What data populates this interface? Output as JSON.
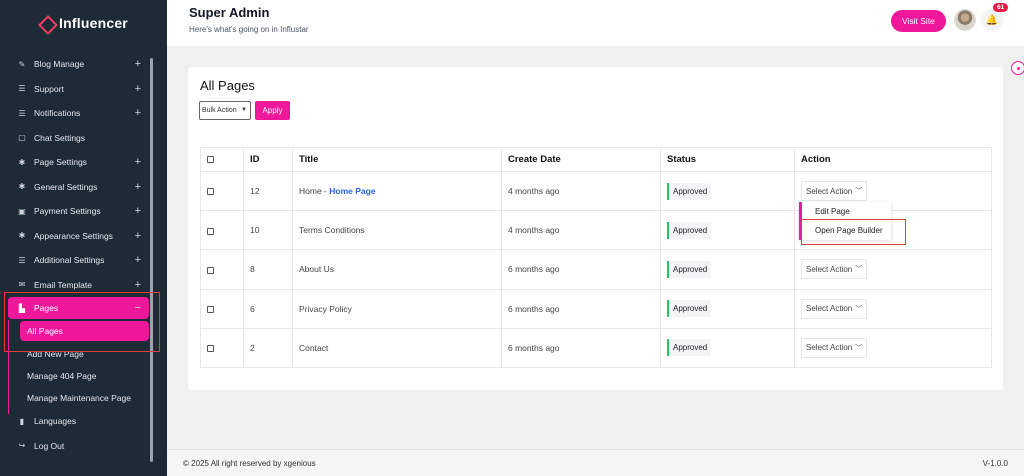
{
  "brand": {
    "name": "Influencer",
    "accent": "#f0189a"
  },
  "header": {
    "title": "Super Admin",
    "subtitle": "Here's what's going on in Influstar",
    "visit_label": "Visit Site",
    "notif_count": "61"
  },
  "sidebar": {
    "items": [
      {
        "label": "Blog Manage",
        "icon": "blog-icon",
        "expandable": true
      },
      {
        "label": "Support",
        "icon": "list-icon",
        "expandable": true
      },
      {
        "label": "Notifications",
        "icon": "list-icon",
        "expandable": true
      },
      {
        "label": "Chat Settings",
        "icon": "chat-icon",
        "expandable": false
      },
      {
        "label": "Page Settings",
        "icon": "gear-icon",
        "expandable": true
      },
      {
        "label": "General Settings",
        "icon": "gear-icon",
        "expandable": true
      },
      {
        "label": "Payment Settings",
        "icon": "briefcase-icon",
        "expandable": true
      },
      {
        "label": "Appearance Settings",
        "icon": "gear-icon",
        "expandable": true
      },
      {
        "label": "Additional Settings",
        "icon": "list-icon",
        "expandable": true
      },
      {
        "label": "Email Template",
        "icon": "envelope-icon",
        "expandable": true
      }
    ],
    "pages": {
      "label": "Pages",
      "collapse": "−",
      "sub": [
        "All Pages",
        "Add New Page",
        "Manage 404 Page",
        "Manage Maintenance Page"
      ]
    },
    "after": [
      {
        "label": "Languages",
        "icon": "bar-chart-icon"
      },
      {
        "label": "Log Out",
        "icon": "logout-icon"
      }
    ]
  },
  "main": {
    "title": "All Pages",
    "bulk_label": "Bulk Action",
    "apply_label": "Apply",
    "columns": [
      "ID",
      "Title",
      "Create Date",
      "Status",
      "Action"
    ],
    "rows": [
      {
        "id": "12",
        "title": "Home - ",
        "title_hl": "Home Page",
        "date": "4 months ago",
        "status": "Approved",
        "action": "Select Action"
      },
      {
        "id": "10",
        "title": "Terms Conditions",
        "title_hl": "",
        "date": "4 months ago",
        "status": "Approved",
        "action": ""
      },
      {
        "id": "8",
        "title": "About Us",
        "title_hl": "",
        "date": "6 months ago",
        "status": "Approved",
        "action": "Select Action"
      },
      {
        "id": "6",
        "title": "Privacy Policy",
        "title_hl": "",
        "date": "6 months ago",
        "status": "Approved",
        "action": "Select Action"
      },
      {
        "id": "2",
        "title": "Contact",
        "title_hl": "",
        "date": "6 months ago",
        "status": "Approved",
        "action": "Select Action"
      }
    ],
    "dropdown": [
      "Edit Page",
      "Open Page Builder"
    ]
  },
  "footer": {
    "copyright": "© 2025 All right reserved by xgenious",
    "version": "V-1.0.0"
  }
}
